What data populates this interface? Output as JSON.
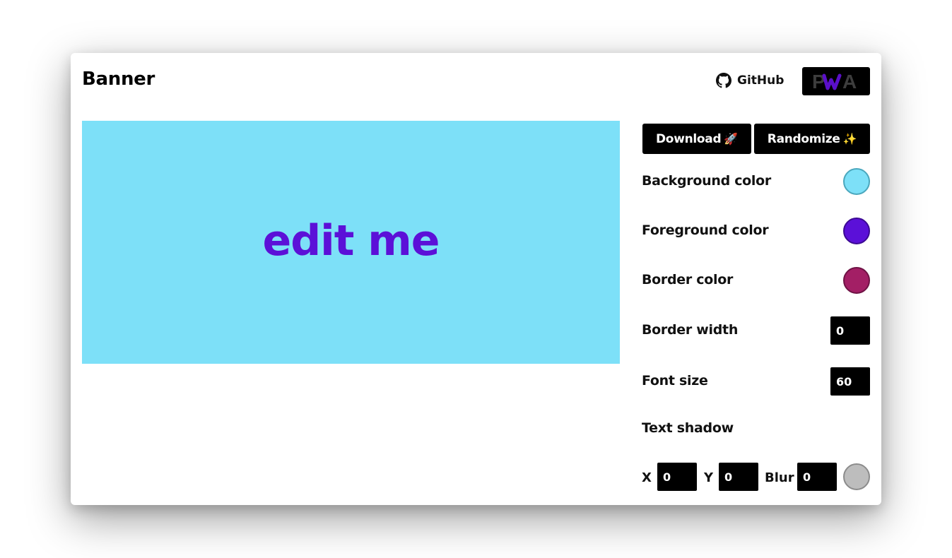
{
  "header": {
    "title": "Banner",
    "github_label": "GitHub",
    "pwa_label": "PWA"
  },
  "banner": {
    "text": "edit me",
    "background_color": "#7de0f8",
    "foreground_color": "#5b10d8",
    "border_color": "#a31f65",
    "border_width": 0,
    "font_size": 60
  },
  "actions": {
    "download_label": "Download",
    "download_emoji": "🚀",
    "randomize_label": "Randomize",
    "randomize_emoji": "✨"
  },
  "controls": {
    "background_color_label": "Background color",
    "foreground_color_label": "Foreground color",
    "border_color_label": "Border color",
    "border_width_label": "Border width",
    "border_width_value": "0",
    "font_size_label": "Font size",
    "font_size_value": "60",
    "text_shadow_label": "Text shadow"
  },
  "text_shadow": {
    "x_label": "X",
    "x_value": "0",
    "y_label": "Y",
    "y_value": "0",
    "blur_label": "Blur",
    "blur_value": "0",
    "color": "#bdbdbd"
  },
  "colors": {
    "background_swatch": "#7de0f8",
    "background_swatch_border": "#4aa7bd",
    "foreground_swatch": "#5b10d8",
    "foreground_swatch_border": "#3c0a93",
    "border_swatch": "#a31f65",
    "border_swatch_border": "#6f1345",
    "shadow_swatch": "#bdbdbd",
    "shadow_swatch_border": "#8c8c8c"
  }
}
